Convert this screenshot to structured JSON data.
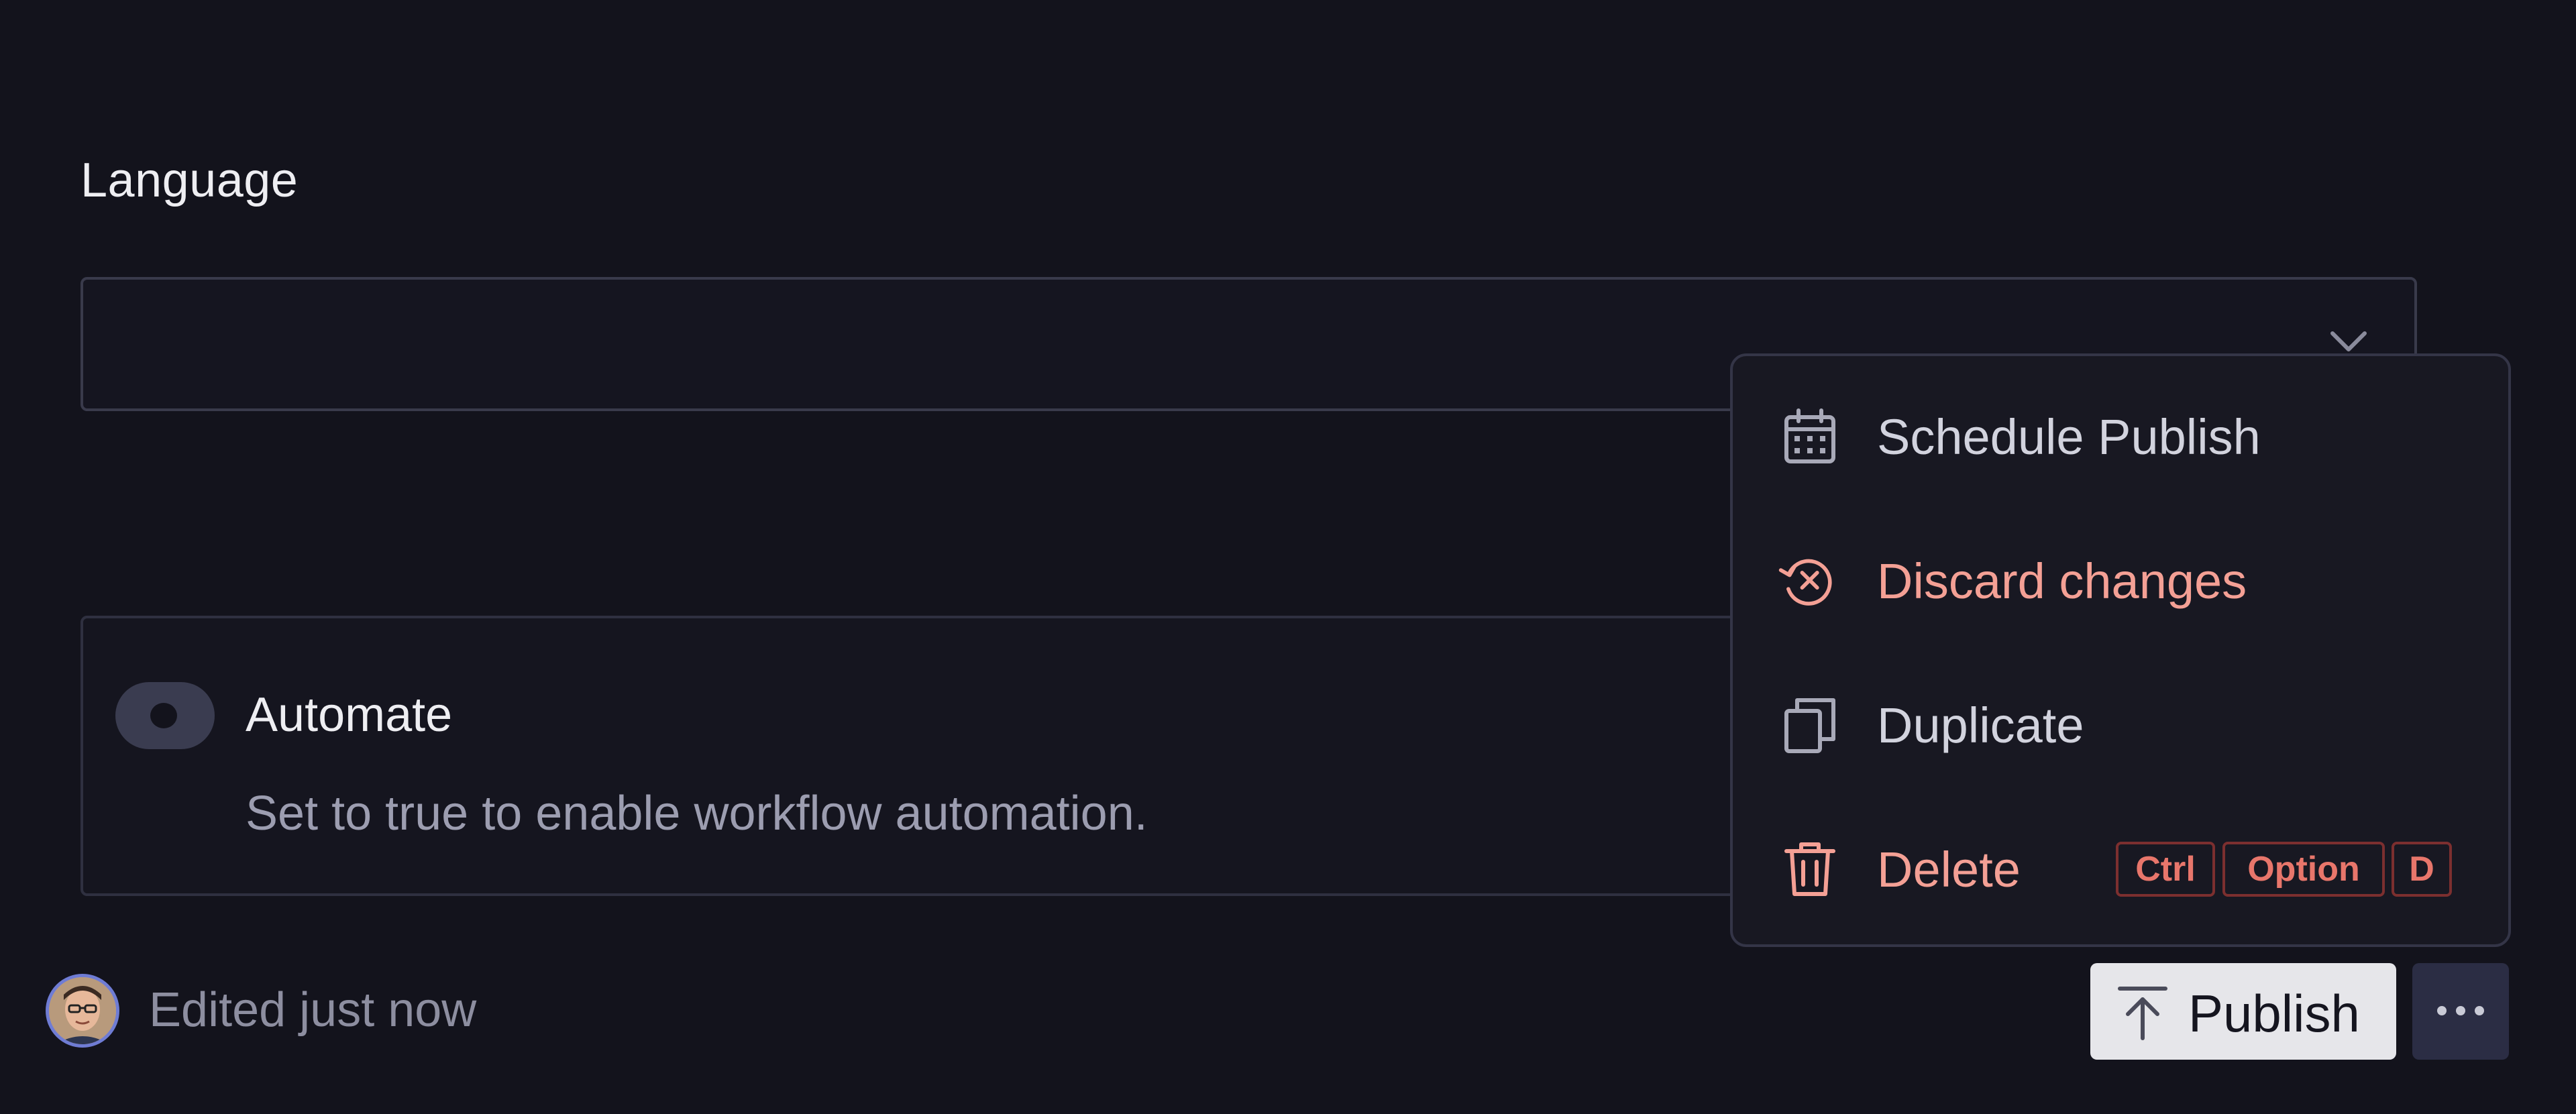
{
  "form": {
    "language_label": "Language",
    "language_value": "",
    "automate": {
      "title": "Automate",
      "description": "Set to true to enable workflow automation.",
      "enabled": false
    }
  },
  "footer": {
    "edited_text": "Edited just now",
    "publish_label": "Publish"
  },
  "menu": {
    "items": [
      {
        "label": "Schedule Publish",
        "icon": "calendar-icon",
        "color": "#d2d3de"
      },
      {
        "label": "Discard changes",
        "icon": "discard-icon",
        "color": "#f4a095"
      },
      {
        "label": "Duplicate",
        "icon": "duplicate-icon",
        "color": "#d2d3de"
      },
      {
        "label": "Delete",
        "icon": "trash-icon",
        "color": "#f4a095",
        "shortcut": [
          "Ctrl",
          "Option",
          "D"
        ]
      }
    ]
  },
  "colors": {
    "background": "#13131c",
    "danger": "#f4a095",
    "publish_bg": "#e6e6ea",
    "avatar_ring": "#6f7cd4"
  }
}
